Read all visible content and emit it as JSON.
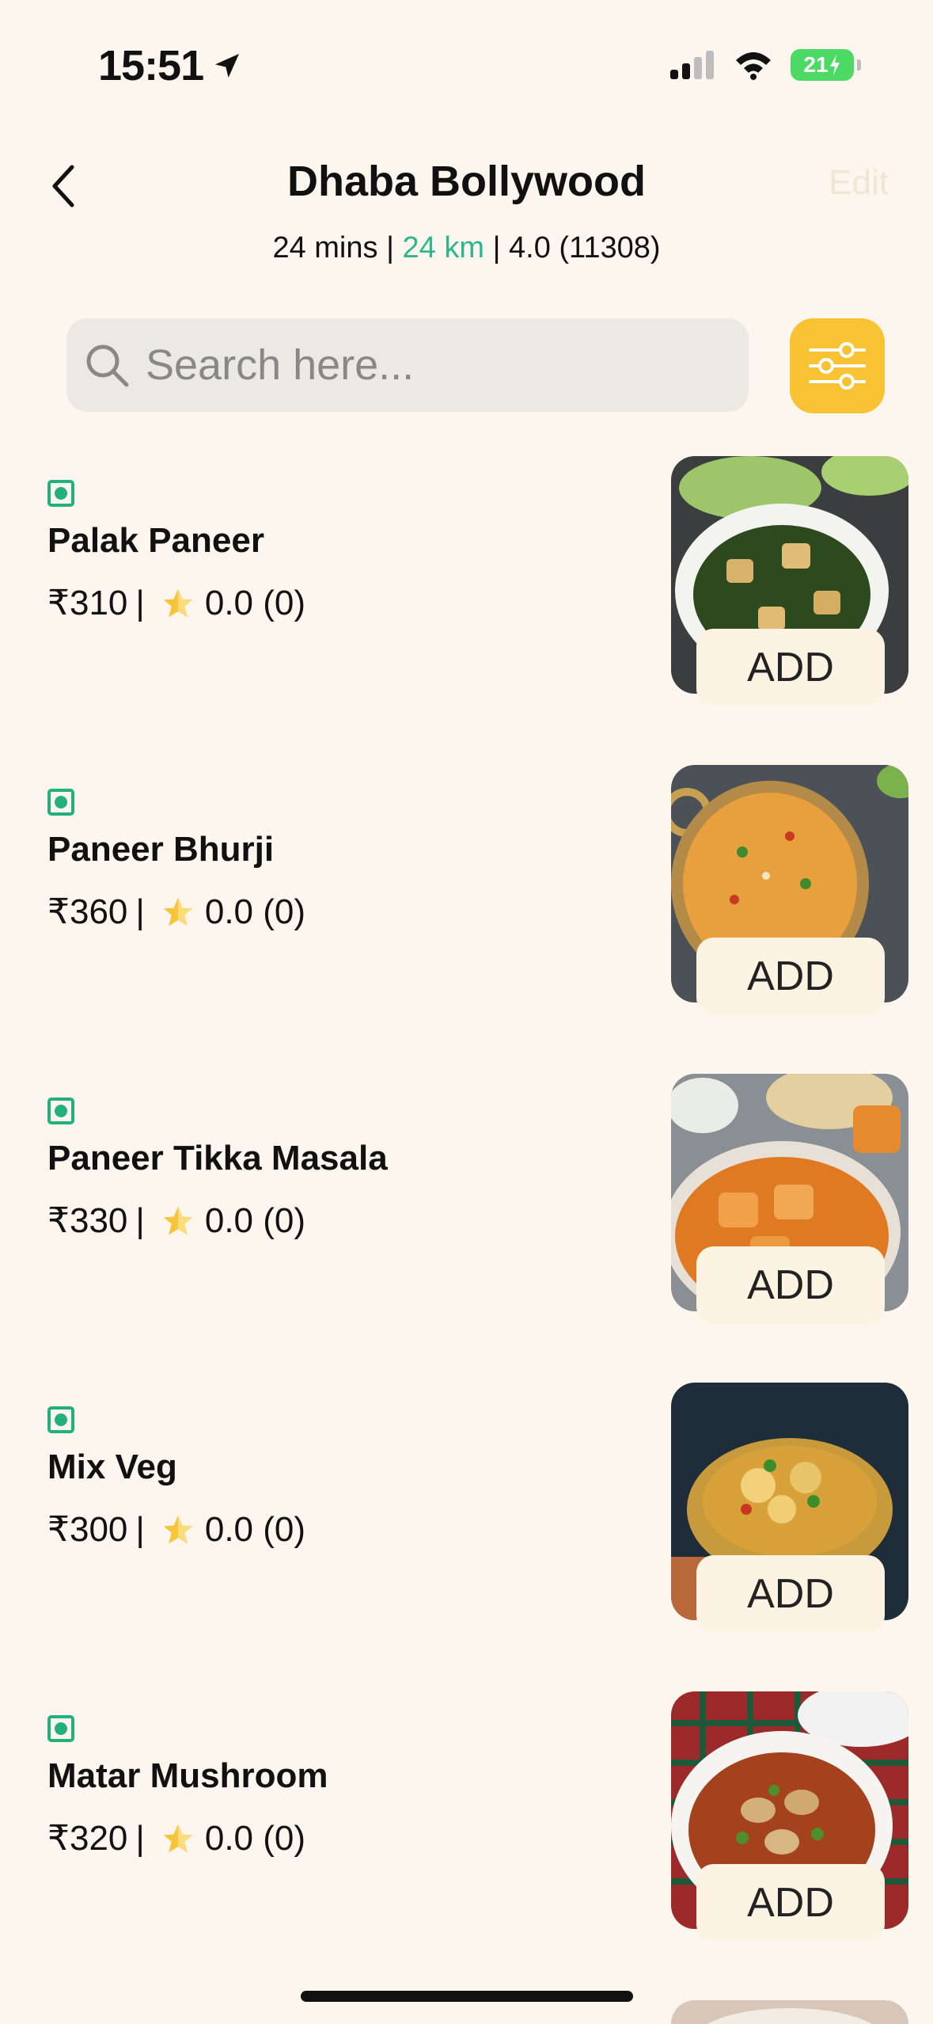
{
  "status_bar": {
    "time": "15:51",
    "battery": "21"
  },
  "header": {
    "title": "Dhaba Bollywood",
    "edit_label": "Edit",
    "time": "24 mins",
    "distance": "24 km",
    "rating": "4.0 (11308)",
    "separator": "|"
  },
  "search": {
    "placeholder": "Search here..."
  },
  "colors": {
    "background": "#fdf6ee",
    "accent_green": "#2fb68e",
    "filter_yellow": "#f9c232",
    "veg_green": "#23b17a"
  },
  "menu": {
    "add_label": "ADD",
    "items": [
      {
        "name": "Palak Paneer",
        "price": "₹310",
        "rating": "0.0",
        "count": "(0)"
      },
      {
        "name": "Paneer Bhurji",
        "price": "₹360",
        "rating": "0.0",
        "count": "(0)"
      },
      {
        "name": "Paneer Tikka Masala",
        "price": "₹330",
        "rating": "0.0",
        "count": "(0)"
      },
      {
        "name": "Mix Veg",
        "price": "₹300",
        "rating": "0.0",
        "count": "(0)"
      },
      {
        "name": "Matar Mushroom",
        "price": "₹320",
        "rating": "0.0",
        "count": "(0)"
      }
    ]
  }
}
